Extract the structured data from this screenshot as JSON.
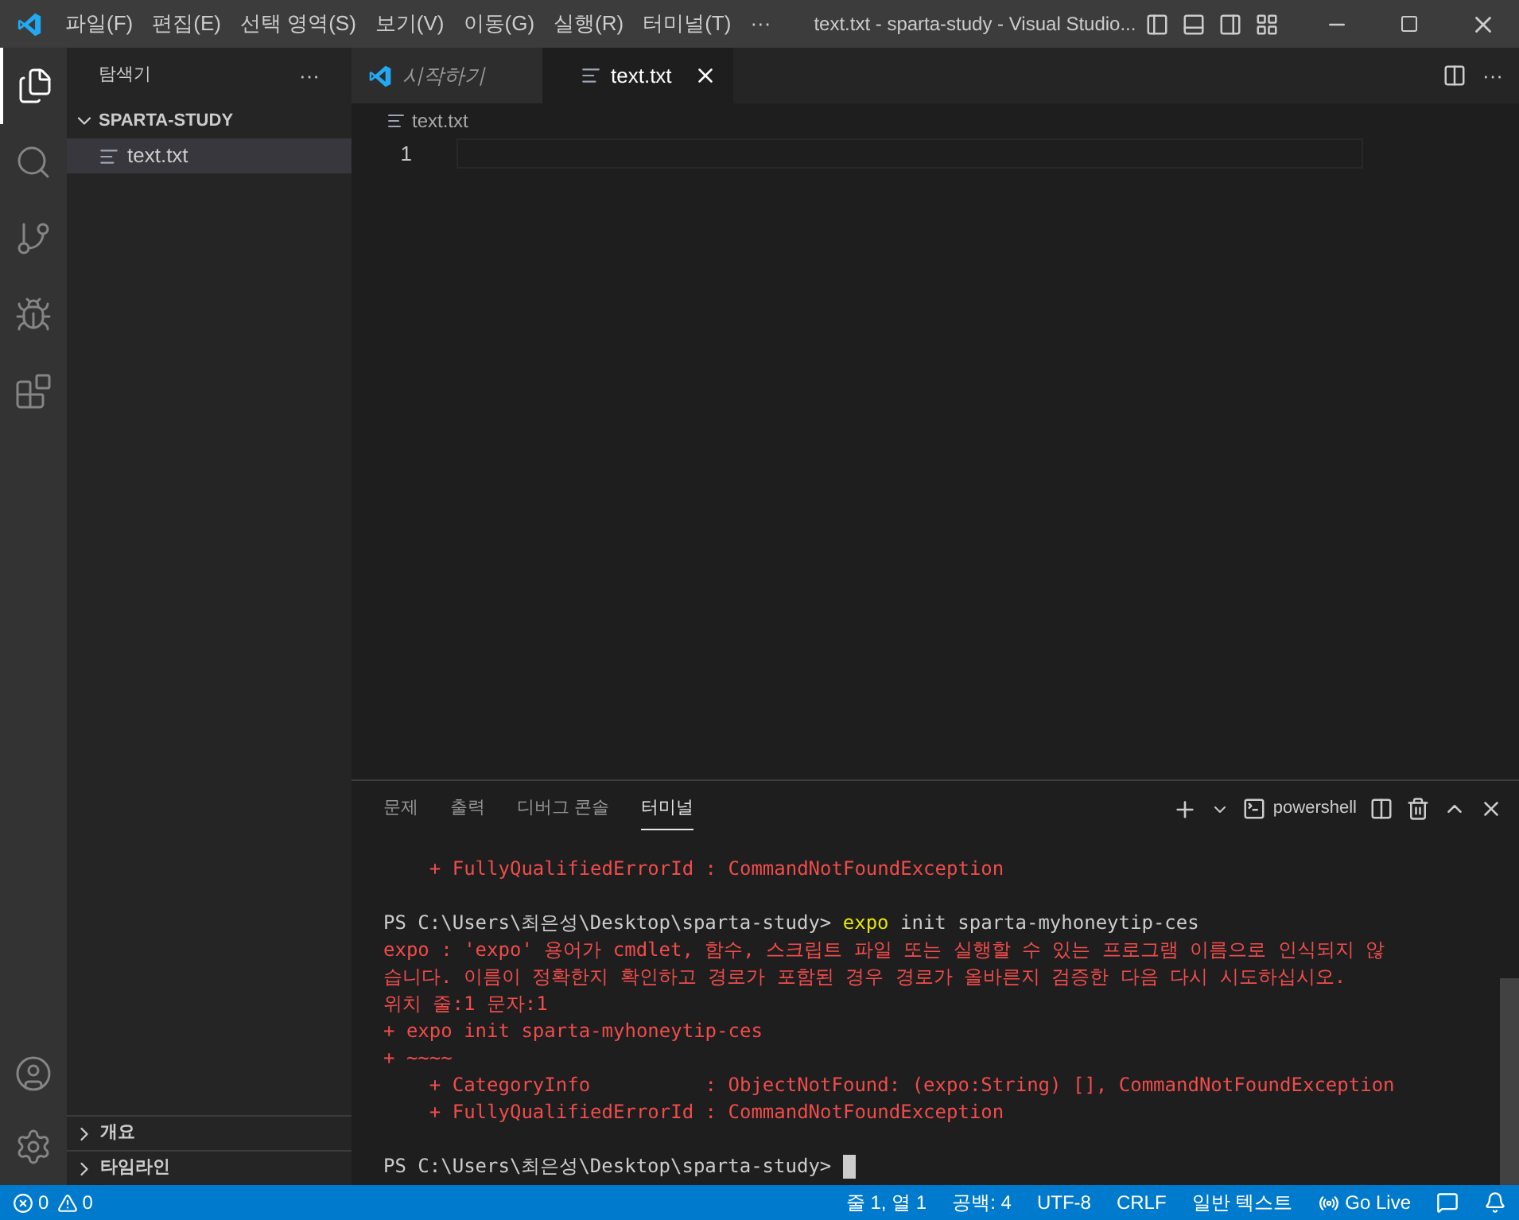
{
  "titlebar": {
    "menus": [
      "파일(F)",
      "편집(E)",
      "선택 영역(S)",
      "보기(V)",
      "이동(G)",
      "실행(R)",
      "터미널(T)",
      "···"
    ],
    "title": "text.txt - sparta-study - Visual Studio..."
  },
  "activity_bar": {
    "items": [
      {
        "kind": "files",
        "selected": true
      },
      {
        "kind": "search",
        "selected": false
      },
      {
        "kind": "source-control",
        "selected": false
      },
      {
        "kind": "run",
        "selected": false
      },
      {
        "kind": "extensions",
        "selected": false
      }
    ]
  },
  "sidebar": {
    "title": "탐색기",
    "more": "···",
    "folder": {
      "name": "SPARTA-STUDY",
      "expanded": true,
      "files": [
        {
          "name": "text.txt",
          "selected": true
        }
      ]
    },
    "sections": [
      {
        "name": "개요",
        "expanded": false
      },
      {
        "name": "타임라인",
        "expanded": false
      }
    ]
  },
  "tabs": [
    {
      "label": "시작하기",
      "kind": "welcome",
      "selected": false
    },
    {
      "label": "text.txt",
      "kind": "file",
      "selected": true
    }
  ],
  "tab_actions_more": "···",
  "breadcrumb": "text.txt",
  "editor": {
    "line_numbers": [
      "1"
    ]
  },
  "panel": {
    "tabs": [
      {
        "label": "문제",
        "selected": false
      },
      {
        "label": "출력",
        "selected": false
      },
      {
        "label": "디버그 콘솔",
        "selected": false
      },
      {
        "label": "터미널",
        "selected": true
      }
    ],
    "shell": "powershell",
    "terminal_blocks": [
      {
        "lines": [
          {
            "segments": [
              {
                "text": "    + FullyQualifiedErrorId : CommandNotFoundException",
                "kind": "error"
              }
            ]
          }
        ]
      },
      {
        "lines": [
          {
            "segments": [
              {
                "text": "PS C:\\Users\\최은성\\Desktop\\sparta-study> ",
                "kind": "normal"
              },
              {
                "text": "expo",
                "kind": "command"
              },
              {
                "text": " init sparta-myhoneytip-ces",
                "kind": "normal"
              }
            ]
          },
          {
            "segments": [
              {
                "text": "expo : 'expo' 용어가 cmdlet, 함수, 스크립트 파일 또는 실행할 수 있는 프로그램 이름으로 인식되지 않",
                "kind": "error"
              }
            ]
          },
          {
            "segments": [
              {
                "text": "습니다. 이름이 정확한지 확인하고 경로가 포함된 경우 경로가 올바른지 검증한 다음 다시 시도하십시오.",
                "kind": "error"
              }
            ]
          },
          {
            "segments": [
              {
                "text": "위치 줄:1 문자:1",
                "kind": "error"
              }
            ]
          },
          {
            "segments": [
              {
                "text": "+ expo init sparta-myhoneytip-ces",
                "kind": "error"
              }
            ]
          },
          {
            "segments": [
              {
                "text": "+ ~~~~",
                "kind": "error"
              }
            ]
          },
          {
            "segments": [
              {
                "text": "    + CategoryInfo          : ObjectNotFound: (expo:String) [], CommandNotFoundException",
                "kind": "error"
              }
            ]
          },
          {
            "segments": [
              {
                "text": "    + FullyQualifiedErrorId : CommandNotFoundException",
                "kind": "error"
              }
            ]
          }
        ]
      },
      {
        "lines": [
          {
            "cursor": true,
            "segments": [
              {
                "text": "PS C:\\Users\\최은성\\Desktop\\sparta-study> ",
                "kind": "normal"
              }
            ]
          }
        ]
      }
    ]
  },
  "status_bar": {
    "errors": "0",
    "warnings": "0",
    "items": [
      {
        "text": "줄 1, 열 1",
        "kind": "text"
      },
      {
        "text": "공백: 4",
        "kind": "text"
      },
      {
        "text": "UTF-8",
        "kind": "text"
      },
      {
        "text": "CRLF",
        "kind": "text"
      },
      {
        "text": "일반 텍스트",
        "kind": "text"
      },
      {
        "text": "Go Live",
        "kind": "live"
      },
      {
        "kind": "feedback"
      },
      {
        "kind": "bell"
      }
    ]
  }
}
